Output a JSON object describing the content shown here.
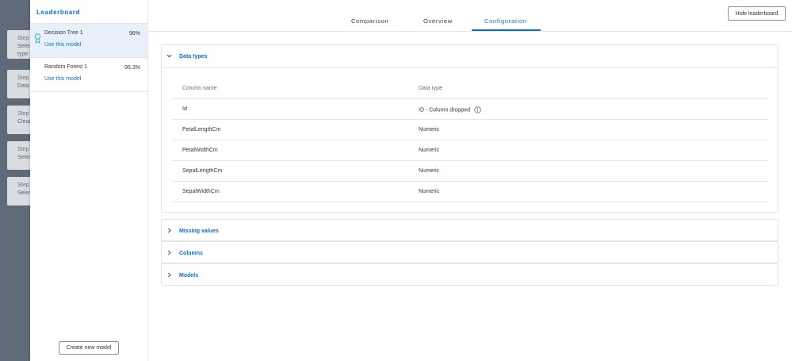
{
  "background_steps": [
    {
      "label": "Step",
      "value": "Selec",
      "extra": "type"
    },
    {
      "label": "Step",
      "value": "Data",
      "extra": ""
    },
    {
      "label": "Step",
      "value": "Clear",
      "extra": ""
    },
    {
      "label": "Step",
      "value": "Selec",
      "extra": ""
    },
    {
      "label": "Step",
      "value": "Selec",
      "extra": ""
    }
  ],
  "leaderboard": {
    "title": "Leaderboard",
    "models": [
      {
        "name": "Decision Tree 1",
        "score": "96%",
        "action": "Use this model"
      },
      {
        "name": "Random Forest 1",
        "score": "95.3%",
        "action": "Use this model"
      }
    ],
    "create_label": "Create new model"
  },
  "tabs": [
    "Comparison",
    "Overview",
    "Configuration"
  ],
  "hide_label": "Hide leaderboard",
  "sections": {
    "data_types": {
      "title": "Data types",
      "columns": [
        "Column name",
        "Data type"
      ],
      "rows": [
        [
          "Id",
          "ID - Column dropped"
        ],
        [
          "PetalLengthCm",
          "Numeric"
        ],
        [
          "PetalWidthCm",
          "Numeric"
        ],
        [
          "SepalLengthCm",
          "Numeric"
        ],
        [
          "SepalWidthCm",
          "Numeric"
        ]
      ]
    },
    "missing_values": {
      "title": "Missing values"
    },
    "columns": {
      "title": "Columns"
    },
    "models": {
      "title": "Models"
    }
  },
  "colors": {
    "accent": "#0a6ed1",
    "selected_bg": "#e8f1fb"
  }
}
